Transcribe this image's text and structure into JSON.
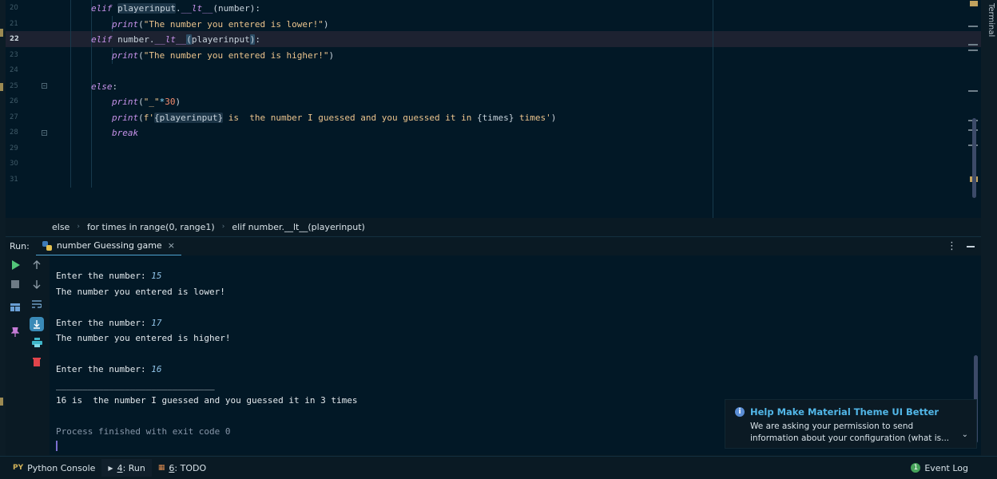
{
  "editor": {
    "line_numbers": [
      "20",
      "21",
      "22",
      "23",
      "24",
      "25",
      "26",
      "27",
      "28",
      "29",
      "30",
      "31"
    ],
    "active_line": "22",
    "code": {
      "l20": {
        "kw": "elif",
        "obj": "playerinput",
        "dot": ".",
        "fn": "__lt__",
        "args": "(number):"
      },
      "l21": {
        "fn": "print",
        "open": "(",
        "str": "\"The number you entered is lower!\"",
        "close": ")"
      },
      "l22": {
        "kw": "elif",
        "obj": "number",
        "dot": ".",
        "fn": "__lt__",
        "paren_open": "(",
        "arg": "playerinput",
        "paren_close": ")",
        "colon": ":"
      },
      "l23": {
        "fn": "print",
        "open": "(",
        "str": "\"The number you entered is higher!\"",
        "close": ")"
      },
      "l25": {
        "kw": "else",
        "colon": ":"
      },
      "l26": {
        "fn": "print",
        "open": "(",
        "str": "\"_\"",
        "op": "*",
        "num": "30",
        "close": ")"
      },
      "l27": {
        "fn": "print",
        "open": "(",
        "prefix": "f'",
        "ph1": "{playerinput}",
        "mid": " is  the number I guessed and you guessed it in ",
        "ph2": "{times}",
        "tail": " times'",
        "close": ")"
      },
      "l28": {
        "kw": "break"
      }
    }
  },
  "breadcrumb": [
    "else",
    "for times in range(0, range1)",
    "elif number.__lt__(playerinput)"
  ],
  "run_panel": {
    "label": "Run:",
    "tab_label": "number Guessing game",
    "tab_close": "×",
    "more_icon": "⋮"
  },
  "console": {
    "lines": [
      {
        "prompt": "Enter the number: ",
        "input": "15"
      },
      {
        "text": "The number you entered is lower!"
      },
      {
        "prompt": "Enter the number: ",
        "input": "17"
      },
      {
        "text": "The number you entered is higher!"
      },
      {
        "prompt": "Enter the number: ",
        "input": "16"
      },
      {
        "text": "______________________________"
      },
      {
        "text": "16 is  the number I guessed and you guessed it in 3 times"
      },
      {
        "text": "Process finished with exit code 0"
      }
    ]
  },
  "notification": {
    "title": "Help Make Material Theme UI Better",
    "body": "We are asking your permission to send information about your configuration (what is...",
    "icon": "i",
    "expand_icon": "⌄"
  },
  "statusbar": {
    "python_console": {
      "icon": "PY",
      "label": "Python Console"
    },
    "run": {
      "icon": "▶",
      "number": "4",
      "label": ": Run"
    },
    "todo": {
      "icon": "▦",
      "number": "6",
      "label": ": TODO"
    },
    "event_log": {
      "icon": "1",
      "label": "Event Log"
    }
  },
  "right_strip": {
    "terminal_label": "Terminal"
  },
  "colors": {
    "background": "#021826",
    "keyword": "#c792ea",
    "string": "#ecc48d",
    "number": "#f78c6c",
    "accent": "#4fa3d1",
    "run_green": "#53c67a",
    "notification_title": "#52b7e8"
  }
}
